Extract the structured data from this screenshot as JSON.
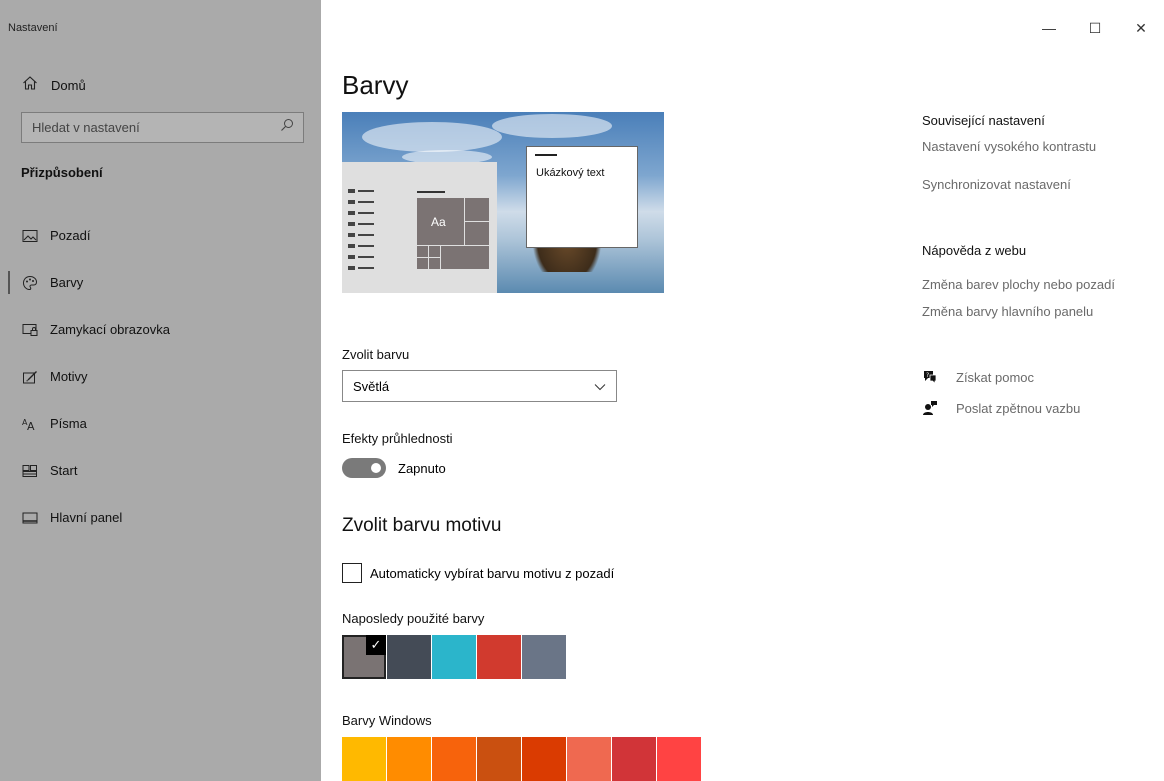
{
  "window": {
    "title": "Nastavení",
    "controls": {
      "minimize": "—",
      "maximize": "☐",
      "close": "✕"
    }
  },
  "sidebar": {
    "home_label": "Domů",
    "search_placeholder": "Hledat v nastavení",
    "section_label": "Přizpůsobení",
    "items": [
      {
        "label": "Pozadí",
        "icon": "picture-icon"
      },
      {
        "label": "Barvy",
        "icon": "palette-icon",
        "active": true
      },
      {
        "label": "Zamykací obrazovka",
        "icon": "lock-screen-icon"
      },
      {
        "label": "Motivy",
        "icon": "themes-icon"
      },
      {
        "label": "Písma",
        "icon": "fonts-icon"
      },
      {
        "label": "Start",
        "icon": "start-icon"
      },
      {
        "label": "Hlavní panel",
        "icon": "taskbar-icon"
      }
    ]
  },
  "main": {
    "page_title": "Barvy",
    "preview": {
      "sample_text": "Ukázkový text",
      "tile_text": "Aa"
    },
    "choose_color": {
      "label": "Zvolit barvu",
      "value": "Světlá"
    },
    "transparency": {
      "label": "Efekty průhlednosti",
      "state_label": "Zapnuto",
      "on": true
    },
    "accent_heading": "Zvolit barvu motivu",
    "auto_accent": {
      "label": "Automaticky vybírat barvu motivu z pozadí",
      "checked": false
    },
    "recent_colors": {
      "label": "Naposledy použité barvy",
      "colors": [
        "#7a7373",
        "#444b56",
        "#2bb5cb",
        "#d13a2e",
        "#6a7587"
      ],
      "selected_index": 0
    },
    "windows_colors": {
      "label": "Barvy Windows",
      "colors": [
        "#ffb900",
        "#ff8c00",
        "#f7630c",
        "#ca5010",
        "#da3b01",
        "#ef6950",
        "#d13438",
        "#ff4343"
      ]
    }
  },
  "related": {
    "heading": "Související nastavení",
    "links": [
      "Nastavení vysokého kontrastu",
      "Synchronizovat nastavení"
    ]
  },
  "web_help": {
    "heading": "Nápověda z webu",
    "links": [
      "Změna barev plochy nebo pozadí",
      "Změna barvy hlavního panelu"
    ]
  },
  "actions": {
    "get_help": {
      "label": "Získat pomoc",
      "icon": "help-chat-icon"
    },
    "feedback": {
      "label": "Poslat zpětnou vazbu",
      "icon": "feedback-icon"
    }
  }
}
